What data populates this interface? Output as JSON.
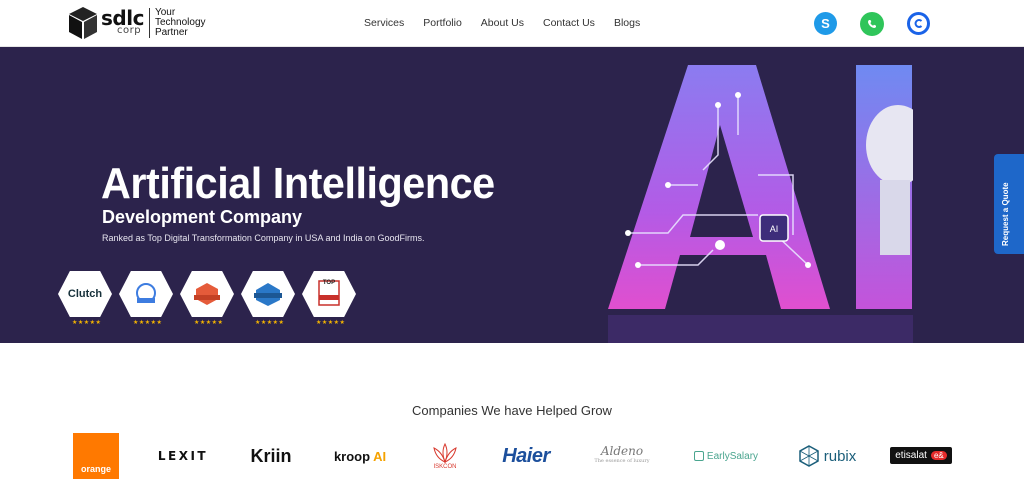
{
  "header": {
    "logo": {
      "word": "sdlc",
      "corp": "corp",
      "tagline": "Your Technology Partner"
    },
    "nav": [
      "Services",
      "Portfolio",
      "About Us",
      "Contact Us",
      "Blogs"
    ],
    "social": [
      {
        "name": "skype",
        "icon": "skype-icon",
        "glyph": "S",
        "color": "#1f9ae8"
      },
      {
        "name": "whatsapp",
        "icon": "whatsapp-icon",
        "color": "#2fc55a"
      },
      {
        "name": "calendly",
        "icon": "calendly-icon",
        "color": "#1a63e8"
      }
    ]
  },
  "hero": {
    "title": "Artificial Intelligence",
    "subtitle": "Development Company",
    "description": "Ranked as Top Digital Transformation Company in USA and India on GoodFirms.",
    "art_text": "AI",
    "background": "#2c234c",
    "badges": [
      {
        "name": "clutch",
        "label": "Clutch",
        "stars": "★★★★★"
      },
      {
        "name": "goodfirms",
        "stars": "★★★★★"
      },
      {
        "name": "appfutura",
        "stars": "★★★★★"
      },
      {
        "name": "topdevelopers",
        "stars": "★★★★★"
      },
      {
        "name": "top-company",
        "label": "TOP",
        "stars": "★★★★★"
      }
    ]
  },
  "quote_tab": {
    "label": "Request a Quote"
  },
  "clients": {
    "title": "Companies We have Helped Grow",
    "logos": {
      "orange": "orange",
      "lexit": "LEXIT",
      "kriin": "Kriin",
      "kroop": "kroop",
      "kroop_ai": "AI",
      "iskcon": "ISKCON",
      "haier": "Haier",
      "aldeno": "Aldeno",
      "aldeno_tag": "The essence of luxury",
      "early": "EarlySalary",
      "rubix": "rubix",
      "etisalat": "etisalat"
    }
  }
}
